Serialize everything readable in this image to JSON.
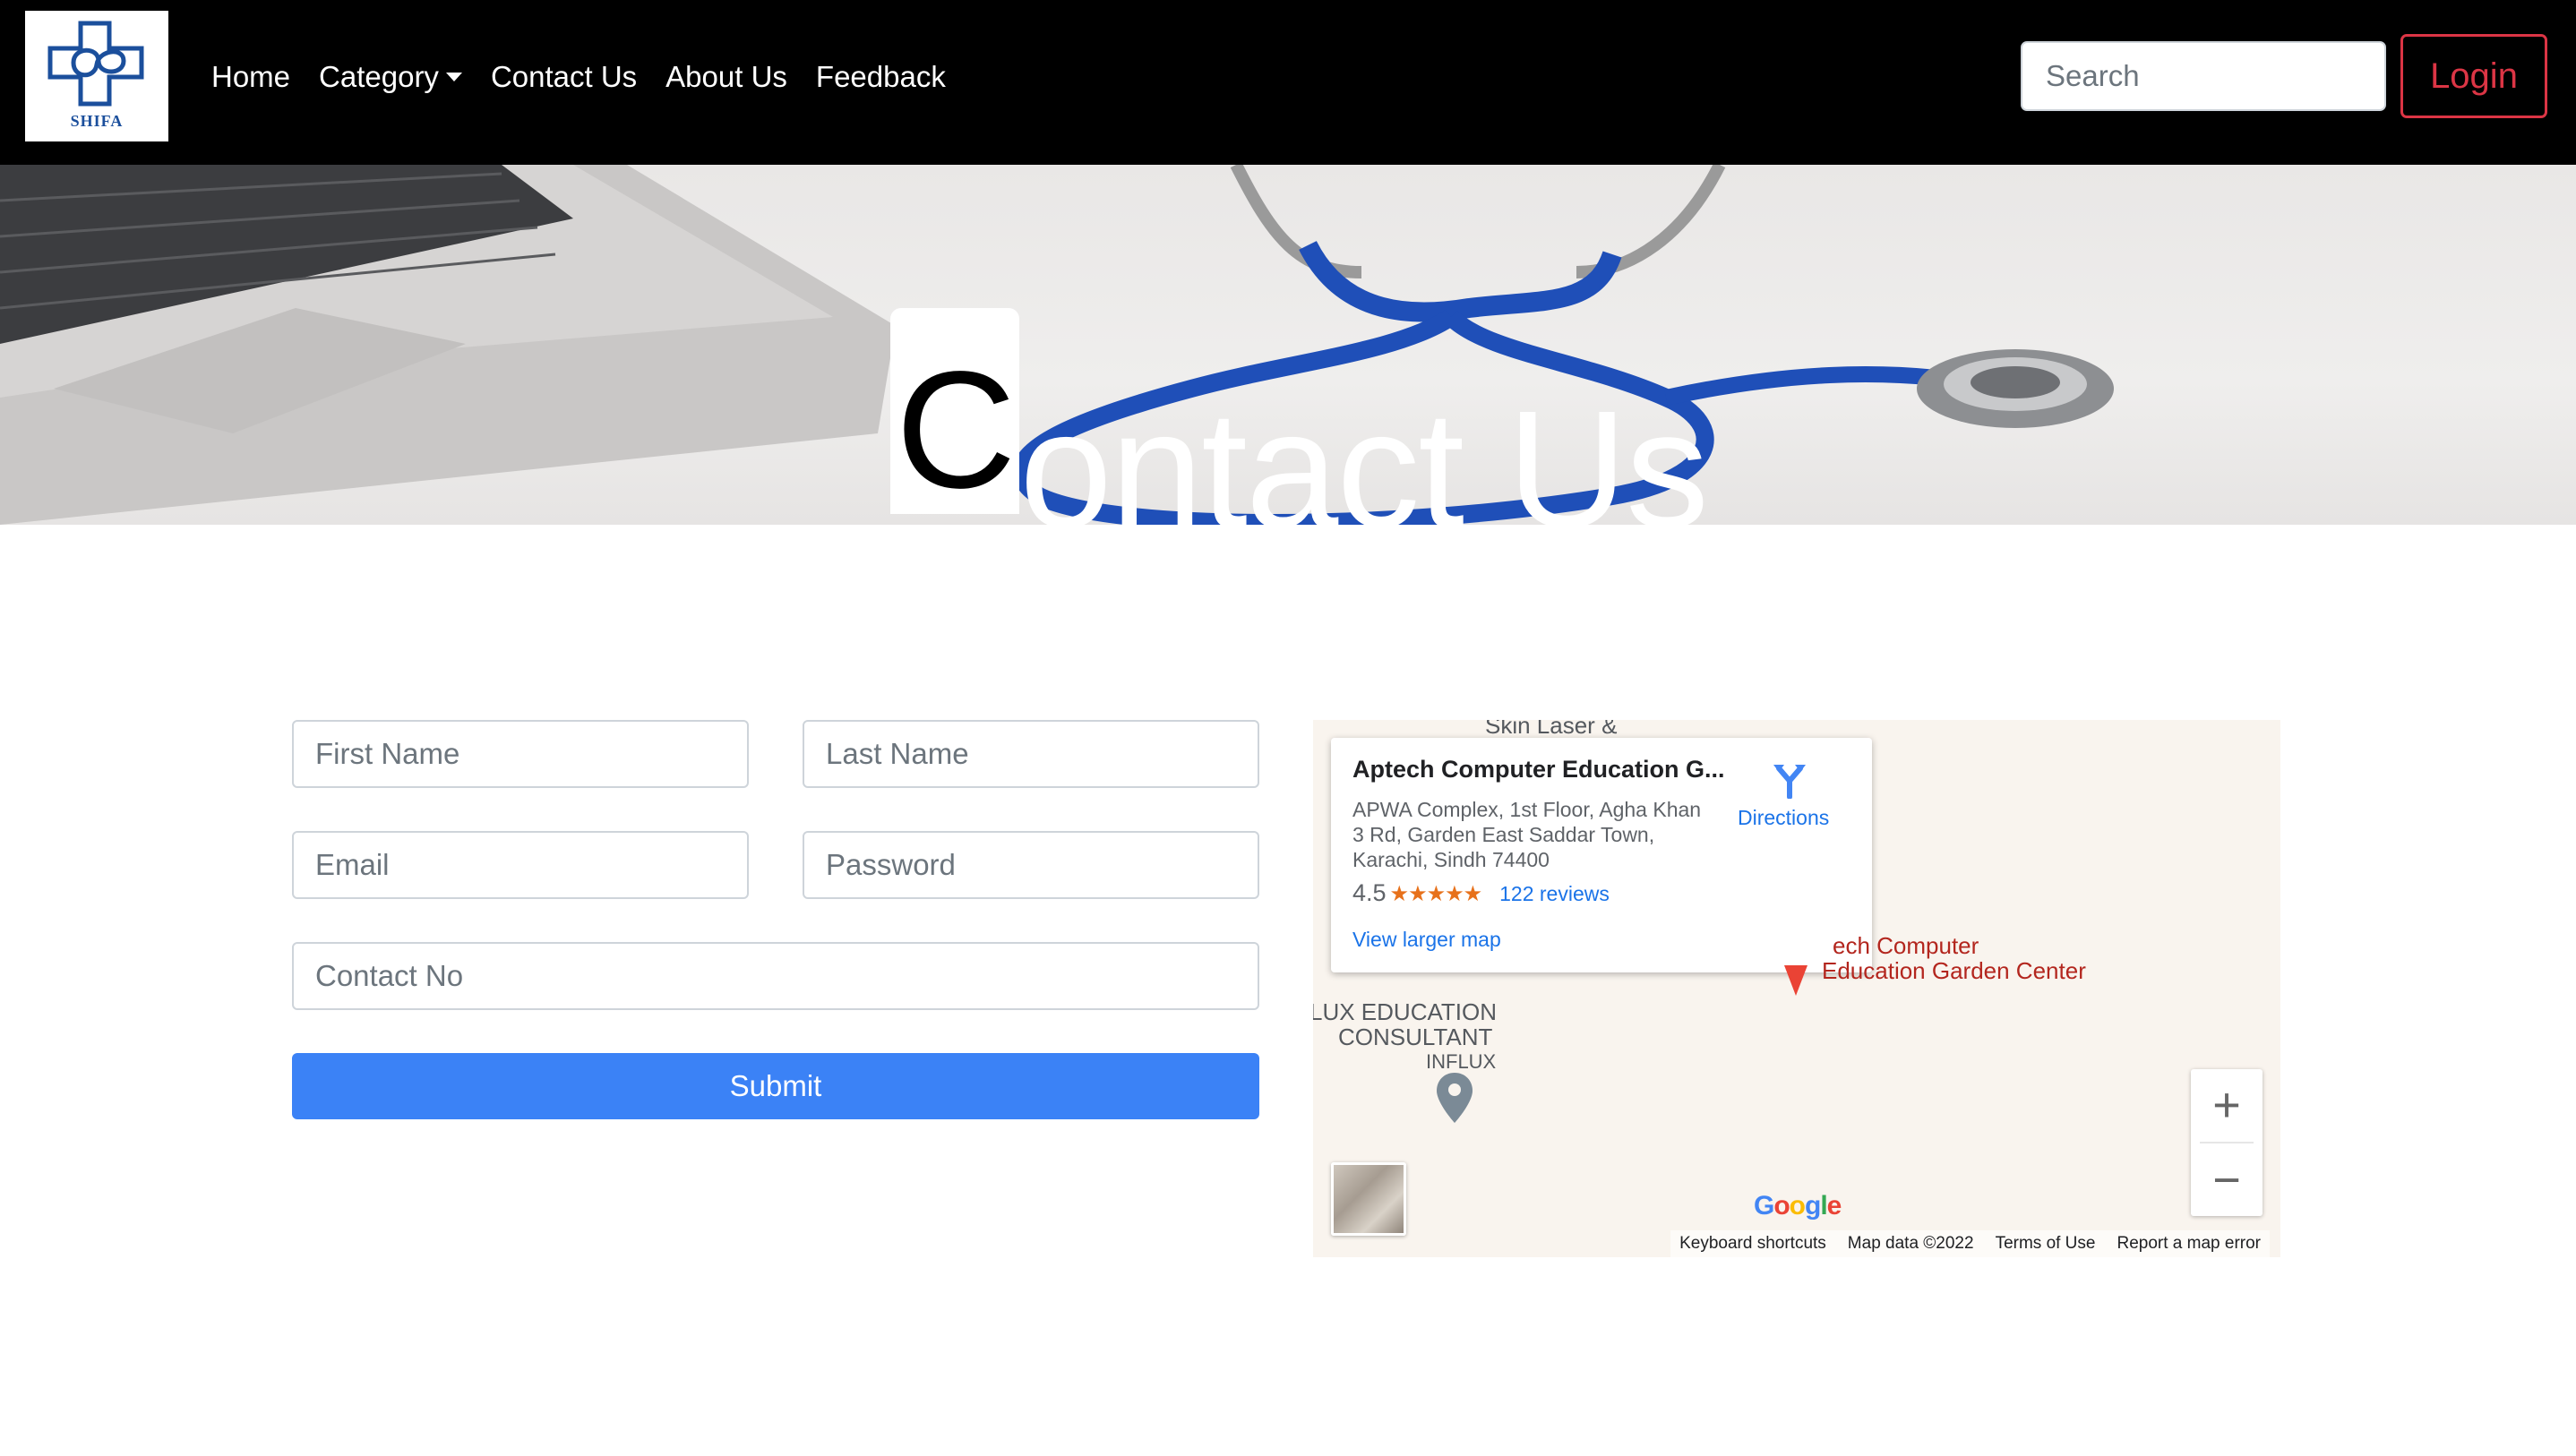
{
  "navbar": {
    "logo_text": "SHIFA",
    "links": {
      "home": "Home",
      "category": "Category",
      "contact": "Contact Us",
      "about": "About Us",
      "feedback": "Feedback"
    },
    "search_placeholder": "Search",
    "login_label": "Login"
  },
  "hero": {
    "title_first": "C",
    "title_rest": "ontact Us"
  },
  "form": {
    "first_name_placeholder": "First Name",
    "last_name_placeholder": "Last Name",
    "email_placeholder": "Email",
    "password_placeholder": "Password",
    "contact_placeholder": "Contact No",
    "submit_label": "Submit"
  },
  "map": {
    "card": {
      "title": "Aptech Computer Education G...",
      "address_line1": "APWA Complex, 1st Floor, Agha Khan",
      "address_line2": "3 Rd, Garden East Saddar Town,",
      "address_line3": "Karachi, Sindh 74400",
      "rating": "4.5",
      "stars": "★★★★★",
      "reviews": "122 reviews",
      "view_larger": "View larger map",
      "directions": "Directions"
    },
    "labels": {
      "top_cut": "Skin Laser &",
      "place_red_line1": "ech Computer",
      "place_red_line2": "Education Garden Center",
      "lux_line1": "LUX EDUCATION",
      "lux_line2": "CONSULTANT",
      "influx": "INFLUX"
    },
    "zoom_in": "+",
    "zoom_out": "−",
    "google": "Google",
    "footer": {
      "shortcuts": "Keyboard shortcuts",
      "map_data": "Map data ©2022",
      "terms": "Terms of Use",
      "report": "Report a map error"
    }
  }
}
